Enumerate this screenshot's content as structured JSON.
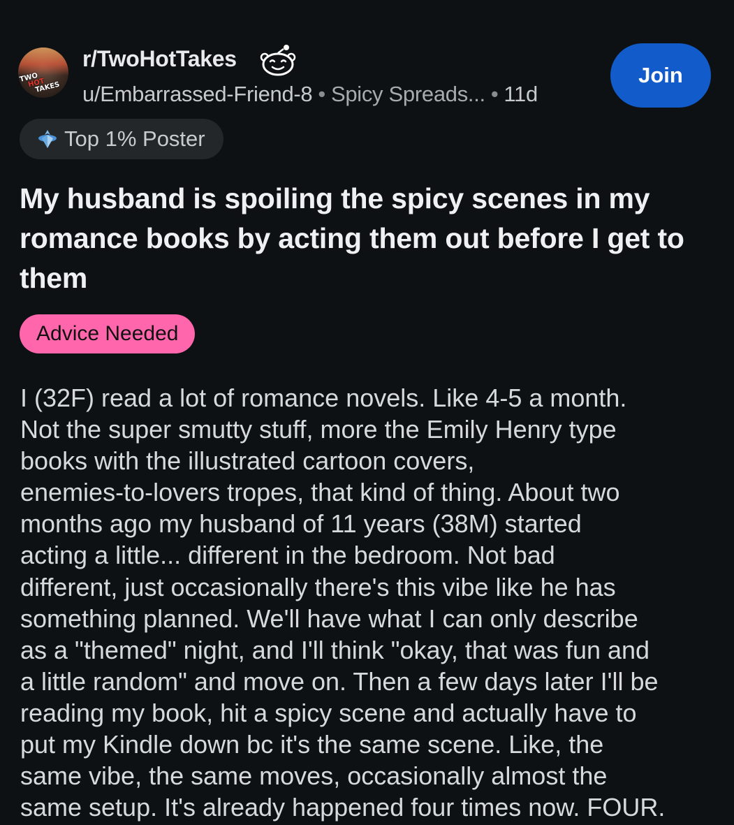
{
  "post": {
    "subreddit": "r/TwoHotTakes",
    "author": "u/Embarrassed-Friend-8",
    "separator": "•",
    "user_flair": "Spicy Spreads...",
    "age": "11d",
    "join_label": "Join",
    "badge_label": "Top 1% Poster",
    "avatar_text": [
      "TWO",
      "HOT",
      "TAKES"
    ],
    "title": "My husband is spoiling the spicy scenes in my romance books by acting them out before I get to them",
    "post_flair": "Advice Needed",
    "body_lines": [
      "I (32F) read a lot of romance novels. Like 4-5 a month.",
      "Not the super smutty stuff, more the Emily Henry type",
      "books with the illustrated cartoon covers,",
      "enemies-to-lovers tropes, that kind of thing. About two",
      "months ago my husband of 11 years (38M) started",
      "acting a little... different in the bedroom. Not bad",
      "different, just occasionally there's this vibe like he has",
      "something planned. We'll have what I can only describe",
      "as a \"themed\" night, and I'll think \"okay, that was fun and",
      "a little random\" and move on. Then a few days later I'll be",
      "reading my book, hit a spicy scene and actually have to",
      "put my Kindle down bc it's the same scene. Like, the",
      "same vibe, the same moves, occasionally almost the",
      "same setup. It's already happened four times now. FOUR."
    ]
  },
  "icons": {
    "avatar": "subreddit-avatar",
    "snoo": "snoo-avatar-icon",
    "badge": "top-poster-badge-icon"
  },
  "colors": {
    "background": "#0e1113",
    "join_button": "#115bca",
    "flair_pink": "#ff66ac",
    "badge_bg": "#23272a"
  }
}
